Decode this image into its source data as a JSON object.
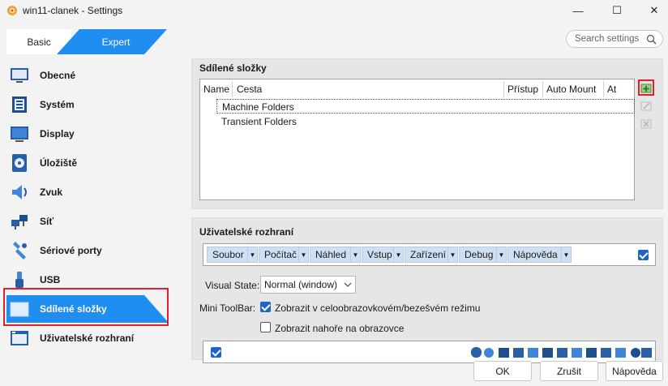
{
  "window": {
    "title": "win11-clanek - Settings",
    "min_glyph": "—",
    "max_glyph": "☐",
    "close_glyph": "✕"
  },
  "mode": {
    "basic": "Basic",
    "expert": "Expert",
    "active": "Expert"
  },
  "search": {
    "placeholder": "Search settings"
  },
  "sidebar": {
    "items": [
      {
        "label": "Obecné",
        "icon": "general-icon"
      },
      {
        "label": "Systém",
        "icon": "system-icon"
      },
      {
        "label": "Display",
        "icon": "display-icon"
      },
      {
        "label": "Úložiště",
        "icon": "storage-icon"
      },
      {
        "label": "Zvuk",
        "icon": "audio-icon"
      },
      {
        "label": "Síť",
        "icon": "network-icon"
      },
      {
        "label": "Sériové porty",
        "icon": "serial-ports-icon"
      },
      {
        "label": "USB",
        "icon": "usb-icon"
      },
      {
        "label": "Sdílené složky",
        "icon": "shared-folders-icon"
      },
      {
        "label": "Uživatelské rozhraní",
        "icon": "user-interface-icon"
      }
    ],
    "selected": "Sdílené složky"
  },
  "shared_folders": {
    "title": "Sdílené složky",
    "columns": [
      "Name",
      "Cesta",
      "Přístup",
      "Auto Mount",
      "At"
    ],
    "rows": [
      "Machine Folders",
      "Transient Folders"
    ],
    "tools": [
      "add-shared-folder-icon",
      "edit-shared-folder-icon",
      "remove-shared-folder-icon"
    ]
  },
  "user_interface": {
    "title": "Uživatelské rozhraní",
    "menus": [
      "Soubor",
      "Počítač",
      "Náhled",
      "Vstup",
      "Zařízení",
      "Debug",
      "Nápověda"
    ],
    "menubar_enabled": true,
    "visual_state_label": "Visual State:",
    "visual_state_value": "Normal (window)",
    "mini_toolbar_label": "Mini ToolBar:",
    "mini_toolbar_fullscreen": "Zobrazit v celoobrazovkovém/bezešvém režimu",
    "mini_toolbar_fullscreen_checked": true,
    "mini_toolbar_top": "Zobrazit nahoře na obrazovce",
    "mini_toolbar_top_checked": false,
    "statusbar_enabled": true
  },
  "buttons": {
    "ok": "OK",
    "cancel": "Zrušit",
    "help": "Nápověda"
  },
  "colors": {
    "accent": "#1f8ef0",
    "highlight_outline": "#e0202c",
    "menu_item": "#cfe0f3"
  }
}
